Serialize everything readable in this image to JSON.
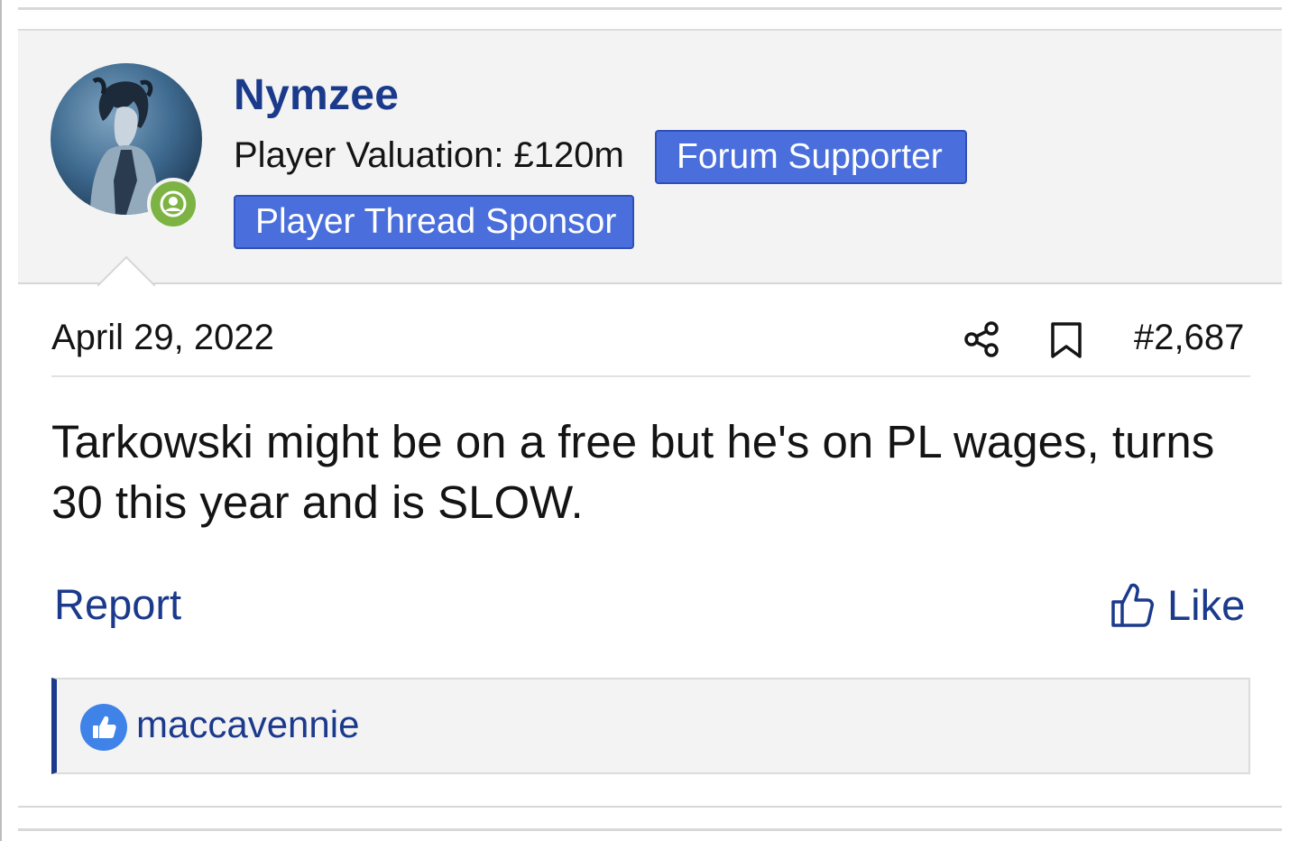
{
  "post": {
    "author": "Nymzee",
    "valuation": "Player Valuation: £120m",
    "badges": [
      "Forum Supporter",
      "Player Thread Sponsor"
    ],
    "date": "April 29, 2022",
    "post_number": "#2,687",
    "body": "Tarkowski might be on a free but he's on PL wages, turns 30 this year and is SLOW.",
    "actions": {
      "report": "Report",
      "like": "Like"
    },
    "reactions": {
      "users": "maccavennie"
    }
  },
  "colors": {
    "accent": "#1b3a8c",
    "badge": "#4a6fdc",
    "online": "#7cb342",
    "reaction": "#3f83e8"
  },
  "icons": [
    "avatar-image",
    "online-status-icon",
    "share-icon",
    "bookmark-icon",
    "thumbs-up-icon",
    "like-reaction-icon"
  ]
}
